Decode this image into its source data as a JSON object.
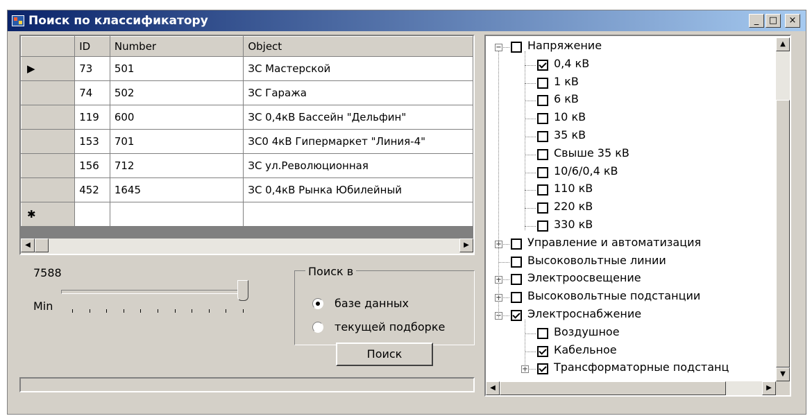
{
  "window": {
    "title": "Поиск по классификатору",
    "buttons": {
      "minimize": "_",
      "maximize": "□",
      "close": "×"
    }
  },
  "grid": {
    "columns": [
      "ID",
      "Number",
      "Object"
    ],
    "rows": [
      {
        "marker": "▶",
        "id": "73",
        "number": "501",
        "object": "ЗС Мастерской"
      },
      {
        "marker": "",
        "id": "74",
        "number": "502",
        "object": "ЗС Гаража"
      },
      {
        "marker": "",
        "id": "119",
        "number": "600",
        "object": "ЗС 0,4кВ Бассейн \"Дельфин\""
      },
      {
        "marker": "",
        "id": "153",
        "number": "701",
        "object": "ЗС0 4кВ Гипермаркет \"Линия-4\""
      },
      {
        "marker": "",
        "id": "156",
        "number": "712",
        "object": "ЗС ул.Революционная"
      },
      {
        "marker": "",
        "id": "452",
        "number": "1645",
        "object": "ЗС 0,4кВ Рынка Юбилейный"
      }
    ],
    "new_row_marker": "✱",
    "scroll_left": "◀",
    "scroll_right": "▶"
  },
  "count_label": "7588",
  "slider": {
    "label": "Min",
    "value_fraction": 1.0
  },
  "search_in": {
    "title": "Поиск в",
    "options": [
      {
        "label": "базе данных",
        "selected": true
      },
      {
        "label": "текущей подборке",
        "selected": false
      }
    ]
  },
  "search_button": "Поиск",
  "status_text": "",
  "tree": {
    "scroll_up": "▲",
    "scroll_down": "▼",
    "scroll_left": "◀",
    "scroll_right": "▶",
    "expand_plus": "+",
    "collapse_minus": "−",
    "nodes": [
      {
        "label": "Напряжение",
        "checked": false,
        "expander": "minus"
      },
      {
        "label": "0,4 кВ",
        "checked": true
      },
      {
        "label": "1 кВ",
        "checked": false
      },
      {
        "label": "6 кВ",
        "checked": false
      },
      {
        "label": "10 кВ",
        "checked": false
      },
      {
        "label": "35 кВ",
        "checked": false
      },
      {
        "label": "Свыше 35 кВ",
        "checked": false
      },
      {
        "label": "10/6/0,4 кВ",
        "checked": false
      },
      {
        "label": "110 кВ",
        "checked": false
      },
      {
        "label": "220 кВ",
        "checked": false
      },
      {
        "label": "330 кВ",
        "checked": false
      },
      {
        "label": "Управление и автоматизация",
        "checked": false,
        "expander": "plus"
      },
      {
        "label": "Высоковольтные линии",
        "checked": false
      },
      {
        "label": "Электроосвещение",
        "checked": false,
        "expander": "plus"
      },
      {
        "label": "Высоковольтные подстанции",
        "checked": false,
        "expander": "plus"
      },
      {
        "label": "Электроснабжение",
        "checked": true,
        "expander": "minus"
      },
      {
        "label": "Воздушное",
        "checked": false
      },
      {
        "label": "Кабельное",
        "checked": true
      },
      {
        "label": "Трансформаторные подстанц",
        "checked": true,
        "expander": "plus"
      }
    ]
  }
}
